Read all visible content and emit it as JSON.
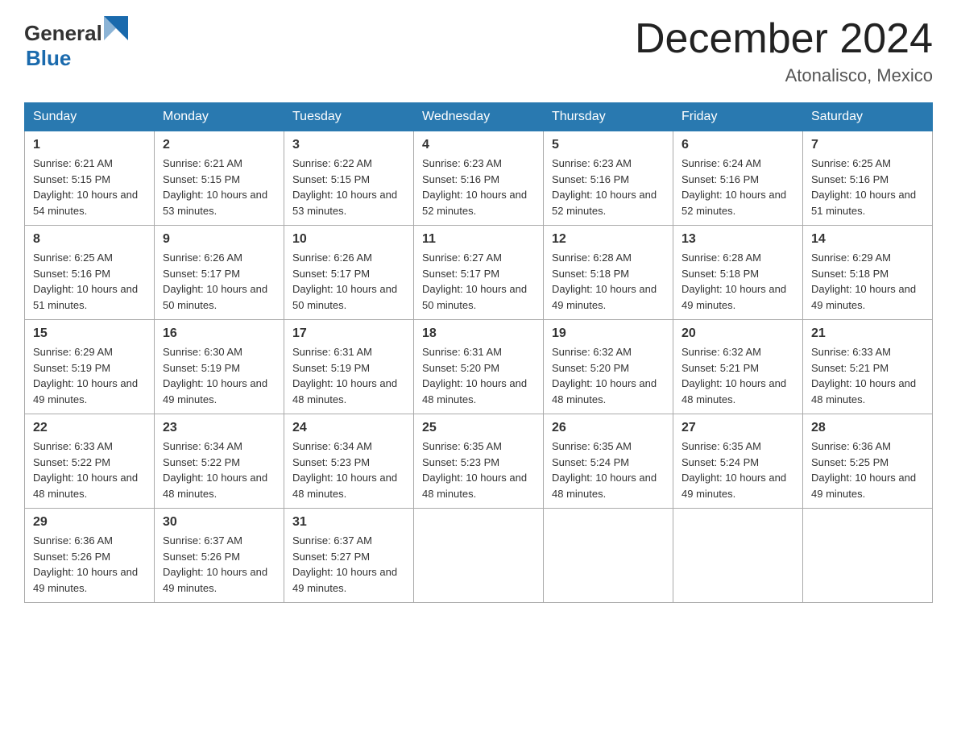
{
  "header": {
    "logo_general": "General",
    "logo_blue": "Blue",
    "month_title": "December 2024",
    "location": "Atonalisco, Mexico"
  },
  "days_of_week": [
    "Sunday",
    "Monday",
    "Tuesday",
    "Wednesday",
    "Thursday",
    "Friday",
    "Saturday"
  ],
  "weeks": [
    [
      {
        "day": "1",
        "sunrise": "6:21 AM",
        "sunset": "5:15 PM",
        "daylight": "10 hours and 54 minutes."
      },
      {
        "day": "2",
        "sunrise": "6:21 AM",
        "sunset": "5:15 PM",
        "daylight": "10 hours and 53 minutes."
      },
      {
        "day": "3",
        "sunrise": "6:22 AM",
        "sunset": "5:15 PM",
        "daylight": "10 hours and 53 minutes."
      },
      {
        "day": "4",
        "sunrise": "6:23 AM",
        "sunset": "5:16 PM",
        "daylight": "10 hours and 52 minutes."
      },
      {
        "day": "5",
        "sunrise": "6:23 AM",
        "sunset": "5:16 PM",
        "daylight": "10 hours and 52 minutes."
      },
      {
        "day": "6",
        "sunrise": "6:24 AM",
        "sunset": "5:16 PM",
        "daylight": "10 hours and 52 minutes."
      },
      {
        "day": "7",
        "sunrise": "6:25 AM",
        "sunset": "5:16 PM",
        "daylight": "10 hours and 51 minutes."
      }
    ],
    [
      {
        "day": "8",
        "sunrise": "6:25 AM",
        "sunset": "5:16 PM",
        "daylight": "10 hours and 51 minutes."
      },
      {
        "day": "9",
        "sunrise": "6:26 AM",
        "sunset": "5:17 PM",
        "daylight": "10 hours and 50 minutes."
      },
      {
        "day": "10",
        "sunrise": "6:26 AM",
        "sunset": "5:17 PM",
        "daylight": "10 hours and 50 minutes."
      },
      {
        "day": "11",
        "sunrise": "6:27 AM",
        "sunset": "5:17 PM",
        "daylight": "10 hours and 50 minutes."
      },
      {
        "day": "12",
        "sunrise": "6:28 AM",
        "sunset": "5:18 PM",
        "daylight": "10 hours and 49 minutes."
      },
      {
        "day": "13",
        "sunrise": "6:28 AM",
        "sunset": "5:18 PM",
        "daylight": "10 hours and 49 minutes."
      },
      {
        "day": "14",
        "sunrise": "6:29 AM",
        "sunset": "5:18 PM",
        "daylight": "10 hours and 49 minutes."
      }
    ],
    [
      {
        "day": "15",
        "sunrise": "6:29 AM",
        "sunset": "5:19 PM",
        "daylight": "10 hours and 49 minutes."
      },
      {
        "day": "16",
        "sunrise": "6:30 AM",
        "sunset": "5:19 PM",
        "daylight": "10 hours and 49 minutes."
      },
      {
        "day": "17",
        "sunrise": "6:31 AM",
        "sunset": "5:19 PM",
        "daylight": "10 hours and 48 minutes."
      },
      {
        "day": "18",
        "sunrise": "6:31 AM",
        "sunset": "5:20 PM",
        "daylight": "10 hours and 48 minutes."
      },
      {
        "day": "19",
        "sunrise": "6:32 AM",
        "sunset": "5:20 PM",
        "daylight": "10 hours and 48 minutes."
      },
      {
        "day": "20",
        "sunrise": "6:32 AM",
        "sunset": "5:21 PM",
        "daylight": "10 hours and 48 minutes."
      },
      {
        "day": "21",
        "sunrise": "6:33 AM",
        "sunset": "5:21 PM",
        "daylight": "10 hours and 48 minutes."
      }
    ],
    [
      {
        "day": "22",
        "sunrise": "6:33 AM",
        "sunset": "5:22 PM",
        "daylight": "10 hours and 48 minutes."
      },
      {
        "day": "23",
        "sunrise": "6:34 AM",
        "sunset": "5:22 PM",
        "daylight": "10 hours and 48 minutes."
      },
      {
        "day": "24",
        "sunrise": "6:34 AM",
        "sunset": "5:23 PM",
        "daylight": "10 hours and 48 minutes."
      },
      {
        "day": "25",
        "sunrise": "6:35 AM",
        "sunset": "5:23 PM",
        "daylight": "10 hours and 48 minutes."
      },
      {
        "day": "26",
        "sunrise": "6:35 AM",
        "sunset": "5:24 PM",
        "daylight": "10 hours and 48 minutes."
      },
      {
        "day": "27",
        "sunrise": "6:35 AM",
        "sunset": "5:24 PM",
        "daylight": "10 hours and 49 minutes."
      },
      {
        "day": "28",
        "sunrise": "6:36 AM",
        "sunset": "5:25 PM",
        "daylight": "10 hours and 49 minutes."
      }
    ],
    [
      {
        "day": "29",
        "sunrise": "6:36 AM",
        "sunset": "5:26 PM",
        "daylight": "10 hours and 49 minutes."
      },
      {
        "day": "30",
        "sunrise": "6:37 AM",
        "sunset": "5:26 PM",
        "daylight": "10 hours and 49 minutes."
      },
      {
        "day": "31",
        "sunrise": "6:37 AM",
        "sunset": "5:27 PM",
        "daylight": "10 hours and 49 minutes."
      },
      null,
      null,
      null,
      null
    ]
  ]
}
